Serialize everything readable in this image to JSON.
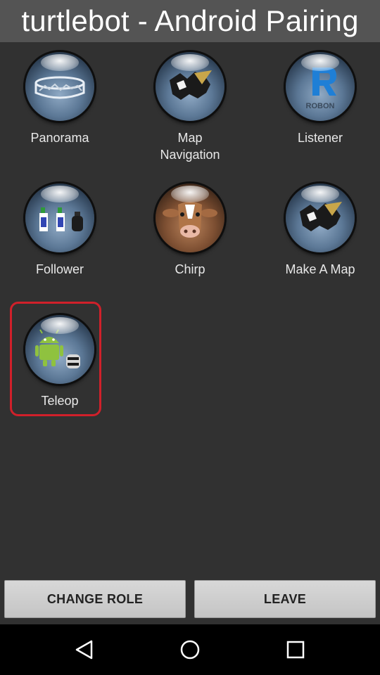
{
  "title": "turtlebot - Android Pairing",
  "apps": [
    {
      "label": "Panorama",
      "icon": "panorama-icon"
    },
    {
      "label": "Map\nNavigation",
      "icon": "map-navigation-icon"
    },
    {
      "label": "Listener",
      "icon": "listener-icon"
    },
    {
      "label": "Follower",
      "icon": "follower-icon"
    },
    {
      "label": "Chirp",
      "icon": "cow-icon"
    },
    {
      "label": "Make A Map",
      "icon": "make-a-map-icon"
    },
    {
      "label": "Teleop",
      "icon": "teleop-icon",
      "selected": true
    }
  ],
  "buttons": {
    "change_role": "CHANGE ROLE",
    "leave": "LEAVE"
  },
  "nav": {
    "back": "back-icon",
    "home": "home-icon",
    "recents": "recents-icon"
  },
  "colors": {
    "selection": "#d0202a",
    "background": "#313131",
    "title_bar": "#545454"
  }
}
